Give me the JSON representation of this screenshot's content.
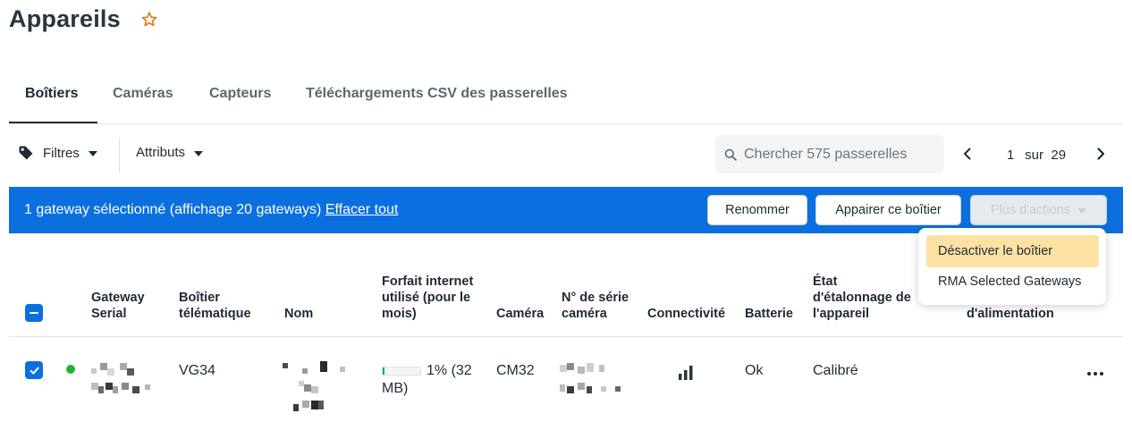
{
  "page": {
    "title": "Appareils"
  },
  "tabs": [
    "Boîtiers",
    "Caméras",
    "Capteurs",
    "Téléchargements CSV des passerelles"
  ],
  "toolbar": {
    "filters_label": "Filtres",
    "attributes_label": "Attributs",
    "search_placeholder": "Chercher 575 passerelles",
    "pager": {
      "current": "1",
      "sep": "sur",
      "total": "29"
    }
  },
  "banner": {
    "text": "1 gateway sélectionné (affichage 20 gateways)",
    "clear_label": "Effacer tout",
    "rename_label": "Renommer",
    "pair_label": "Appairer ce boîtier",
    "more_label": "Plus d'actions"
  },
  "dropdown": {
    "items": [
      "Désactiver le boîtier",
      "RMA Selected Gateways"
    ]
  },
  "table": {
    "headers": {
      "gateway_serial": [
        "Gateway",
        "Serial"
      ],
      "boitier": [
        "Boîtier",
        "télématique"
      ],
      "nom": [
        "Nom"
      ],
      "forfait": [
        "Forfait internet",
        "utilisé (pour le",
        "mois)"
      ],
      "camera": [
        "Caméra"
      ],
      "serie_camera": [
        "N° de série",
        "caméra"
      ],
      "connectivite": [
        "Connectivité"
      ],
      "batterie": [
        "Batterie"
      ],
      "etalonnage": [
        "État",
        "d'étalonnage de",
        "l'appareil"
      ],
      "alimentation": [
        "d'alimentation"
      ]
    },
    "row": {
      "boitier": "VG34",
      "usage_text": [
        "1% (32",
        "MB)"
      ],
      "usage_fraction": 0.01,
      "camera": "CM32",
      "batterie": "Ok",
      "etalonnage": "Calibré"
    }
  },
  "colors": {
    "accent": "#0b6fe0",
    "status_green": "#1fb33a",
    "highlight": "#fde2a3",
    "star": "#e07b1a"
  },
  "icons": [
    "star-icon",
    "tag-icon",
    "search-icon",
    "chevron-left-icon",
    "chevron-right-icon",
    "signal-icon",
    "more-icon"
  ]
}
